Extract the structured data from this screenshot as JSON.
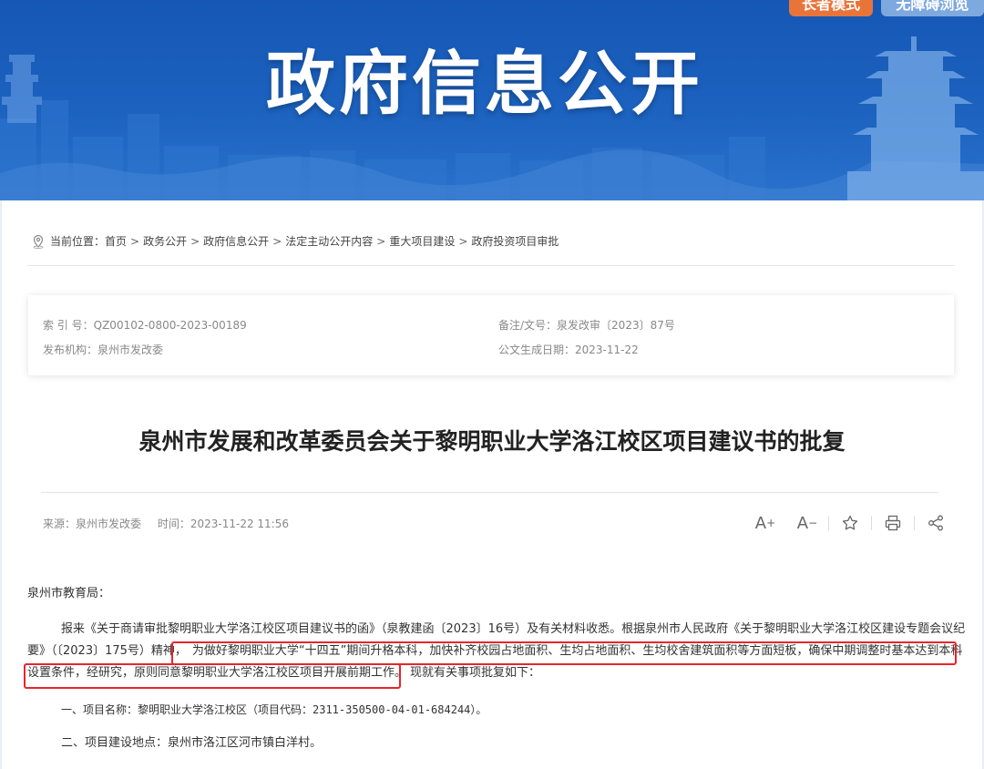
{
  "banner": {
    "title": "政府信息公开",
    "elder_mode": "长者模式",
    "accessible": "无障碍浏览"
  },
  "breadcrumb": {
    "prefix": "当前位置：",
    "items": [
      "首页",
      "政务公开",
      "政府信息公开",
      "法定主动公开内容",
      "重大项目建设",
      "政府投资项目审批"
    ],
    "separator": ">"
  },
  "meta": {
    "index_label": "索 引 号：",
    "index_value": "QZ00102-0800-2023-00189",
    "doc_no_label": "备注/文号：",
    "doc_no_value": "泉发改审〔2023〕87号",
    "publisher_label": "发布机构：",
    "publisher_value": "泉州市发改委",
    "date_label": "公文生成日期：",
    "date_value": "2023-11-22"
  },
  "article": {
    "title": "泉州市发展和改革委员会关于黎明职业大学洛江校区项目建议书的批复",
    "source": "来源：泉州市发改委",
    "time": "时间：2023-11-22 11:56",
    "tools": {
      "font_larger": "A",
      "font_smaller": "A"
    },
    "recipient": "泉州市教育局：",
    "para1_line1": "报来《关于商请审批黎明职业大学洛江校区项目建议书的函》（泉教建函〔2023〕16号）及有关材料收悉。根据泉州市人民政府《关于黎明职业大学洛江校区建设专题会议纪",
    "para1_line2_a": "要》（〔2023〕175号）精神，",
    "para1_line2_b": "为做好黎明职业大学“十四五”期间升格本科，加快补齐校园占地面积、生均占地面积、生均校舍建筑面积等方面短板，确保中期调整时基本达到本科",
    "para1_line3_a": "设置条件，经研究，原则同意黎明职业大学洛江校区项目开展前期工作。",
    "para1_line3_b": "现就有关事项批复如下：",
    "item1": "一、项目名称：黎明职业大学洛江校区（项目代码：2311-350500-04-01-684244）。",
    "item2": "二、项目建设地点：泉州市洛江区河市镇白洋村。"
  },
  "colors": {
    "banner_blue": "#1c62bf",
    "elder_orange": "#e8743a",
    "accessible_blue": "#7ea9df",
    "highlight_red": "#e8252b"
  },
  "icons": [
    "location-icon",
    "font-larger-icon",
    "font-smaller-icon",
    "favorite-star-icon",
    "print-icon",
    "share-icon"
  ]
}
